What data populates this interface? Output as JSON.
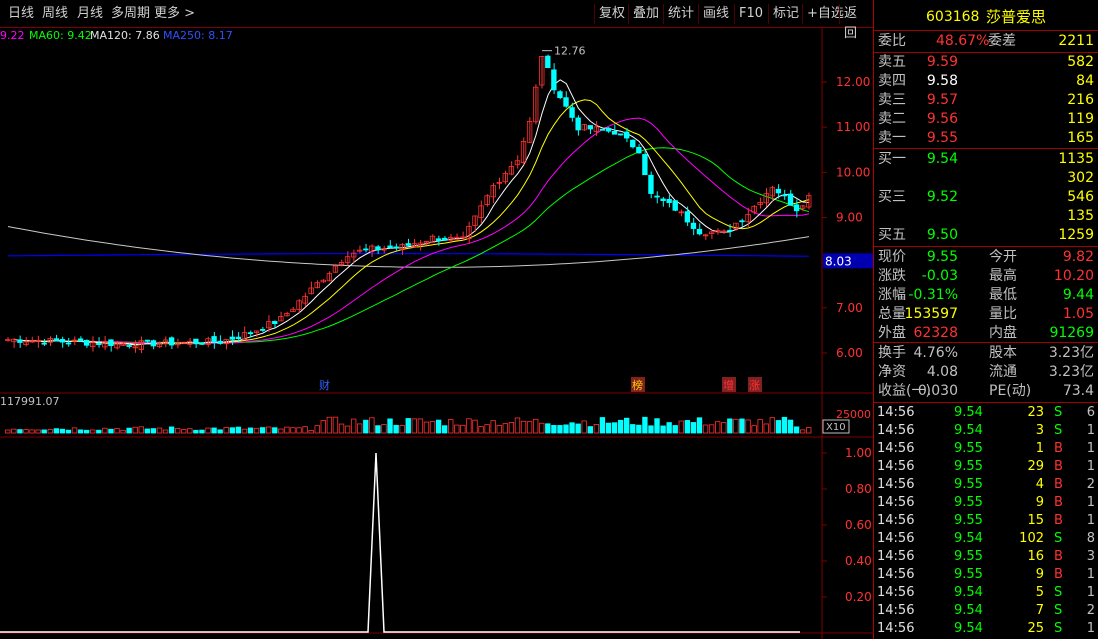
{
  "toolbar": {
    "periods": [
      "日线",
      "周线",
      "月线",
      "多周期",
      "更多 >"
    ],
    "tools": [
      "复权",
      "叠加",
      "统计",
      "画线",
      "F10",
      "标记",
      "+自选",
      "返回"
    ]
  },
  "ma": {
    "ma_first": "9.22",
    "ma60": "MA60: 9.42",
    "ma120": "MA120: 7.86",
    "ma250": "MA250: 8.17"
  },
  "price_chart": {
    "y_ticks": [
      "12.00",
      "11.00",
      "10.00",
      "9.00",
      "8.00",
      "7.00",
      "6.00"
    ],
    "high_label": "12.76",
    "current_price_label": "8.03",
    "markers": [
      "财",
      "榜",
      "增",
      "涨"
    ]
  },
  "volume": {
    "label": "117991.07",
    "tick": "25000",
    "unit": "X10"
  },
  "indicator": {
    "y_ticks": [
      "1.00",
      "0.80",
      "0.60",
      "0.40",
      "0.20"
    ]
  },
  "colors": {
    "up": "#ff3232",
    "down": "#00ffff",
    "ma5": "#ffffff",
    "ma10": "#ffff00",
    "ma20": "#ff00ff",
    "ma60": "#00ff00",
    "ma120": "#ffffff",
    "ma250": "#0000ff",
    "bg": "#000000",
    "grid": "#800000"
  },
  "stock": {
    "code": "603168",
    "name": "莎普爱思"
  },
  "order_book": {
    "ratio_label": "委比",
    "ratio": "48.67%",
    "diff_label": "委差",
    "diff": "2211",
    "asks": [
      {
        "label": "卖五",
        "price": "9.59",
        "vol": "582"
      },
      {
        "label": "卖四",
        "price": "9.58",
        "vol": "84"
      },
      {
        "label": "卖三",
        "price": "9.57",
        "vol": "216"
      },
      {
        "label": "卖二",
        "price": "9.56",
        "vol": "119"
      },
      {
        "label": "卖一",
        "price": "9.55",
        "vol": "165"
      }
    ],
    "bids": [
      {
        "label": "买一",
        "price": "9.54",
        "vol": "1135"
      },
      {
        "label": "",
        "price": "",
        "vol": "302"
      },
      {
        "label": "买三",
        "price": "9.52",
        "vol": "546"
      },
      {
        "label": "",
        "price": "",
        "vol": "135"
      },
      {
        "label": "买五",
        "price": "9.50",
        "vol": "1259"
      }
    ]
  },
  "quote": [
    {
      "l1": "现价",
      "v1": "9.55",
      "l2": "今开",
      "v2": "9.82"
    },
    {
      "l1": "涨跌",
      "v1": "-0.03",
      "l2": "最高",
      "v2": "10.20"
    },
    {
      "l1": "涨幅",
      "v1": "-0.31%",
      "l2": "最低",
      "v2": "9.44"
    },
    {
      "l1": "总量",
      "v1": "153597",
      "l2": "量比",
      "v2": "1.05"
    },
    {
      "l1": "外盘",
      "v1": "62328",
      "l2": "内盘",
      "v2": "91269"
    }
  ],
  "fundamentals": [
    {
      "l1": "换手",
      "v1": "4.76%",
      "l2": "股本",
      "v2": "3.23亿"
    },
    {
      "l1": "净资",
      "v1": "4.08",
      "l2": "流通",
      "v2": "3.23亿"
    },
    {
      "l1": "收益(一)",
      "v1": "0.030",
      "l2": "PE(动)",
      "v2": "73.4"
    }
  ],
  "ticks": [
    {
      "time": "14:56",
      "price": "9.54",
      "vol": "23",
      "side": "S",
      "n": "6"
    },
    {
      "time": "14:56",
      "price": "9.54",
      "vol": "3",
      "side": "S",
      "n": "1"
    },
    {
      "time": "14:56",
      "price": "9.55",
      "vol": "1",
      "side": "B",
      "n": "1"
    },
    {
      "time": "14:56",
      "price": "9.55",
      "vol": "29",
      "side": "B",
      "n": "1"
    },
    {
      "time": "14:56",
      "price": "9.55",
      "vol": "4",
      "side": "B",
      "n": "2"
    },
    {
      "time": "14:56",
      "price": "9.55",
      "vol": "9",
      "side": "B",
      "n": "1"
    },
    {
      "time": "14:56",
      "price": "9.55",
      "vol": "15",
      "side": "B",
      "n": "1"
    },
    {
      "time": "14:56",
      "price": "9.54",
      "vol": "102",
      "side": "S",
      "n": "8"
    },
    {
      "time": "14:56",
      "price": "9.55",
      "vol": "16",
      "side": "B",
      "n": "3"
    },
    {
      "time": "14:56",
      "price": "9.55",
      "vol": "9",
      "side": "B",
      "n": "1"
    },
    {
      "time": "14:56",
      "price": "9.54",
      "vol": "5",
      "side": "S",
      "n": "1"
    },
    {
      "time": "14:56",
      "price": "9.54",
      "vol": "7",
      "side": "S",
      "n": "2"
    },
    {
      "time": "14:56",
      "price": "9.54",
      "vol": "25",
      "side": "S",
      "n": "1"
    }
  ]
}
